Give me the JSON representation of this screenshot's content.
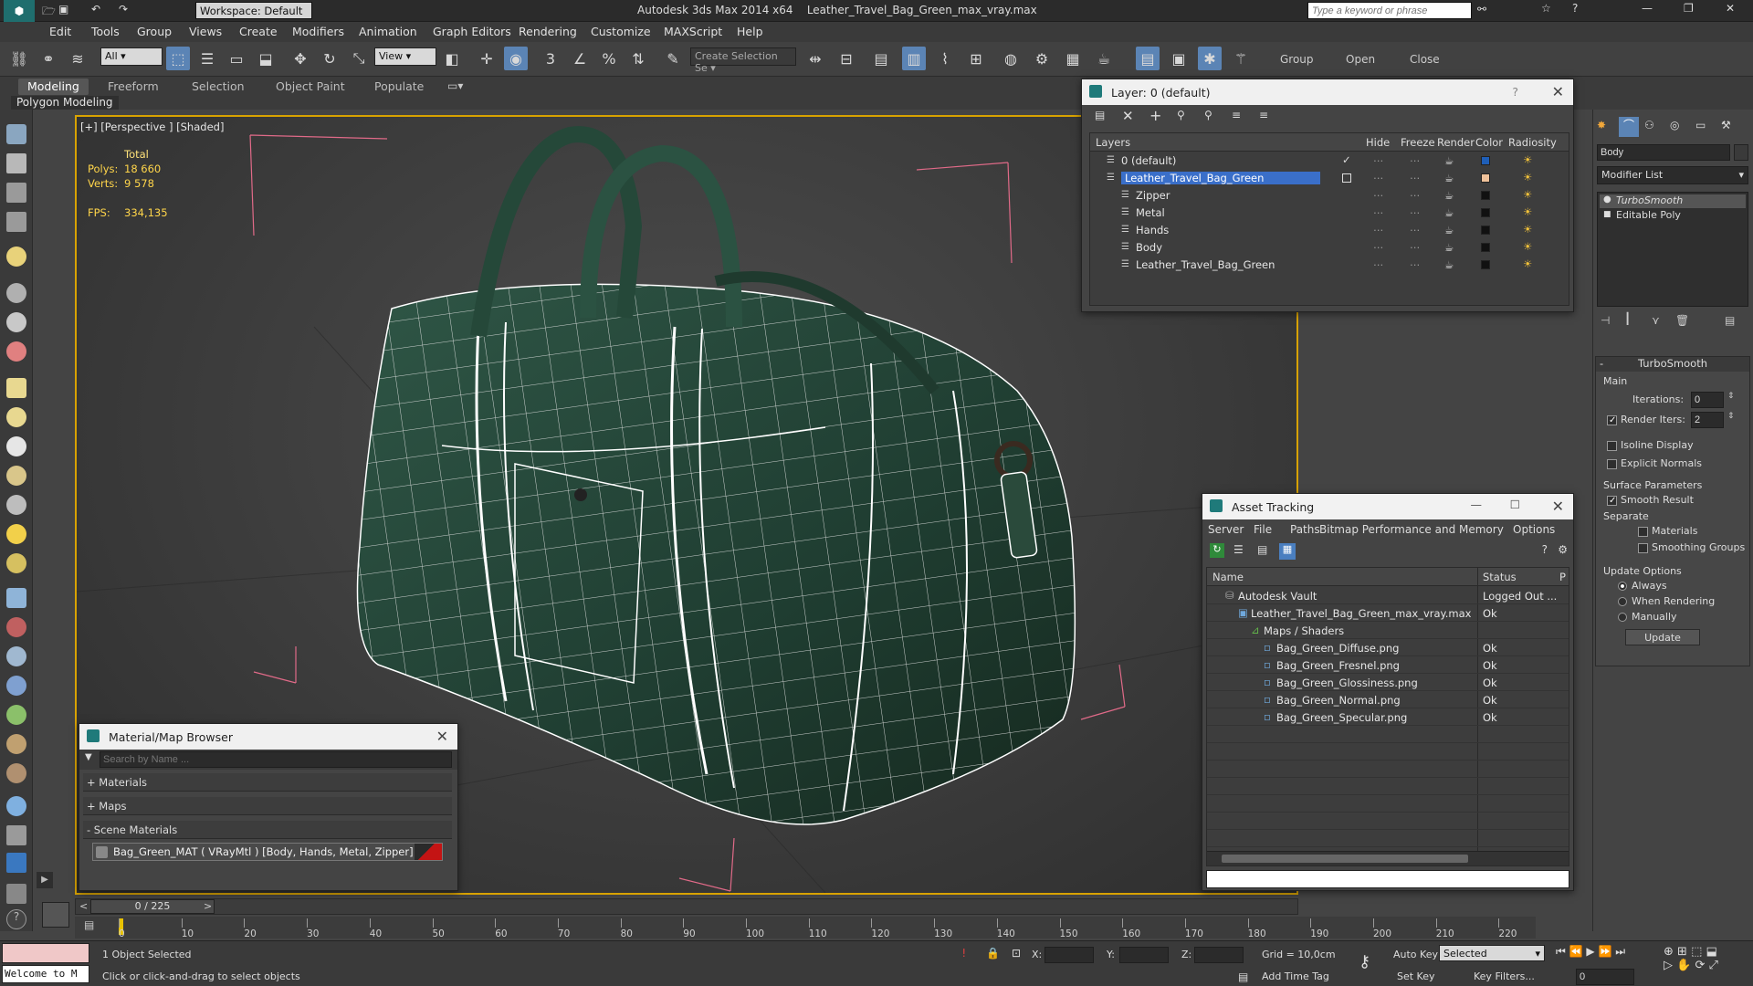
{
  "window": {
    "app_title": "Autodesk 3ds Max  2014 x64",
    "file_title": "Leather_Travel_Bag_Green_max_vray.max",
    "workspace": "Workspace: Default",
    "search_placeholder": "Type a keyword or phrase"
  },
  "menu": [
    "Edit",
    "Tools",
    "Group",
    "Views",
    "Create",
    "Modifiers",
    "Animation",
    "Graph Editors",
    "Rendering",
    "Customize",
    "MAXScript",
    "Help"
  ],
  "toolbar": {
    "filter_select": "All",
    "view_select": "View",
    "named_selection": "Create Selection Se",
    "group_label": "Group",
    "open_label": "Open",
    "close_label": "Close"
  },
  "ribbon": {
    "tabs": [
      "Modeling",
      "Freeform",
      "Selection",
      "Object Paint",
      "Populate"
    ],
    "active_tab": "Modeling",
    "sub_label": "Polygon Modeling"
  },
  "viewport": {
    "label": "[+] [Perspective ] [Shaded]",
    "stats_header": "Total",
    "polys_label": "Polys:",
    "polys_value": "18 660",
    "verts_label": "Verts:",
    "verts_value": "9 578",
    "fps_label": "FPS:",
    "fps_value": "334,135"
  },
  "layer_panel": {
    "title": "Layer: 0 (default)",
    "help": "?",
    "columns": [
      "Layers",
      "Hide",
      "Freeze",
      "Render",
      "Color",
      "Radiosity"
    ],
    "rows": [
      {
        "name": "0 (default)",
        "color": "#1f5fb8"
      },
      {
        "name": "Leather_Travel_Bag_Green",
        "color": "#f0c29a"
      },
      {
        "name": "Zipper",
        "color": "#111111"
      },
      {
        "name": "Metal",
        "color": "#111111"
      },
      {
        "name": "Hands",
        "color": "#111111"
      },
      {
        "name": "Body",
        "color": "#111111"
      },
      {
        "name": "Leather_Travel_Bag_Green",
        "color": "#111111"
      }
    ]
  },
  "asset_panel": {
    "title": "Asset Tracking",
    "menu": [
      "Server",
      "File",
      "Paths",
      "Bitmap Performance and Memory",
      "Options"
    ],
    "col_name": "Name",
    "col_status": "Status",
    "col_extra": "P",
    "rows": [
      {
        "name": "Autodesk Vault",
        "status": "Logged Out ..."
      },
      {
        "name": "Leather_Travel_Bag_Green_max_vray.max",
        "status": "Ok"
      },
      {
        "name": "Maps / Shaders",
        "status": ""
      },
      {
        "name": "Bag_Green_Diffuse.png",
        "status": "Ok"
      },
      {
        "name": "Bag_Green_Fresnel.png",
        "status": "Ok"
      },
      {
        "name": "Bag_Green_Glossiness.png",
        "status": "Ok"
      },
      {
        "name": "Bag_Green_Normal.png",
        "status": "Ok"
      },
      {
        "name": "Bag_Green_Specular.png",
        "status": "Ok"
      }
    ]
  },
  "material_panel": {
    "title": "Material/Map Browser",
    "search_placeholder": "Search by Name ...",
    "sections": [
      "+ Materials",
      "+ Maps",
      "- Scene Materials"
    ],
    "material_entry": "Bag_Green_MAT  ( VRayMtl )  [Body, Hands, Metal, Zipper]"
  },
  "command_panel": {
    "object_name": "Body",
    "modifier_list": "Modifier List",
    "stack": [
      "TurboSmooth",
      "Editable Poly"
    ],
    "rollout_title": "TurboSmooth",
    "main_label": "Main",
    "iterations_label": "Iterations:",
    "iterations_value": "0",
    "render_iters_label": "Render Iters:",
    "render_iters_value": "2",
    "isoline": "Isoline Display",
    "explicit_normals": "Explicit Normals",
    "surface_params": "Surface Parameters",
    "smooth_result": "Smooth Result",
    "separate": "Separate",
    "materials": "Materials",
    "smoothing_groups": "Smoothing Groups",
    "update_options": "Update Options",
    "always": "Always",
    "when_rendering": "When Rendering",
    "manually": "Manually",
    "update_button": "Update"
  },
  "timeline": {
    "frame_counter": "0 / 225",
    "ticks": [
      "0",
      "10",
      "20",
      "30",
      "40",
      "50",
      "60",
      "70",
      "80",
      "90",
      "100",
      "110",
      "120",
      "130",
      "140",
      "150",
      "160",
      "170",
      "180",
      "190",
      "200",
      "210",
      "220"
    ]
  },
  "status": {
    "welcome": "Welcome to M",
    "selected": "1 Object Selected",
    "prompt": "Click or click-and-drag to select objects",
    "x_label": "X:",
    "y_label": "Y:",
    "z_label": "Z:",
    "grid": "Grid = 10,0cm",
    "add_time_tag": "Add Time Tag",
    "auto_key": "Auto Key",
    "set_key": "Set Key",
    "key_mode": "Selected",
    "key_filters": "Key Filters...",
    "frame_value": "0"
  }
}
